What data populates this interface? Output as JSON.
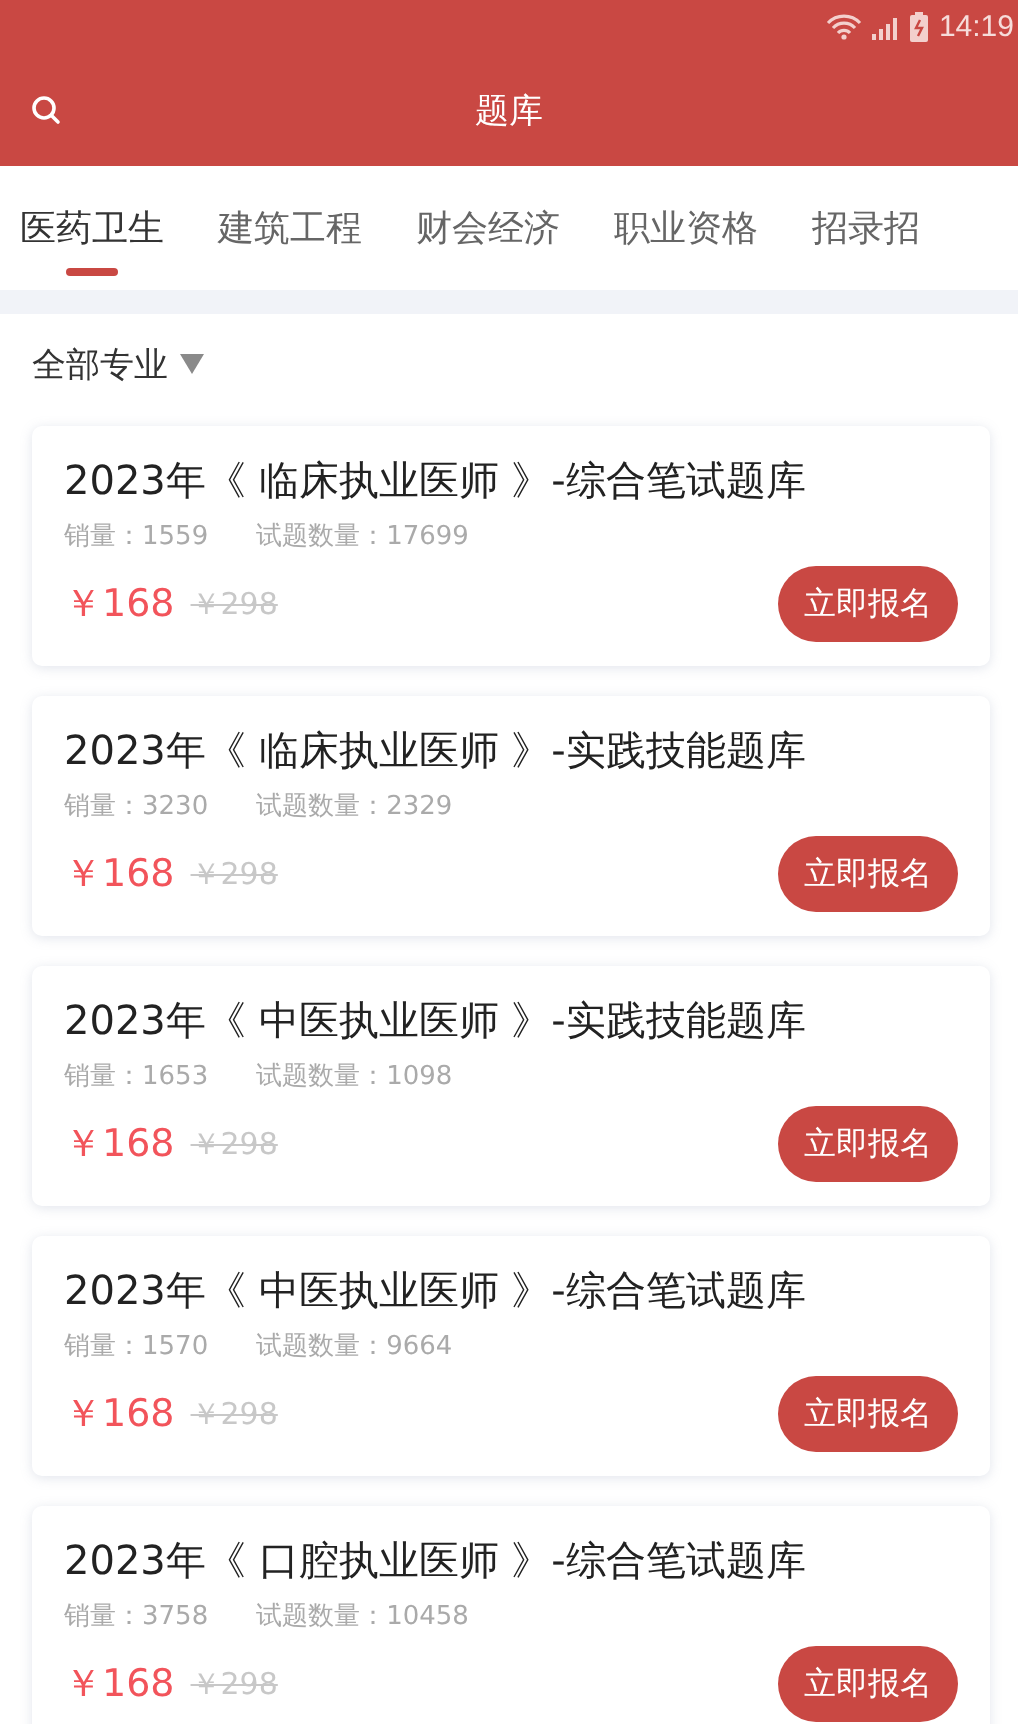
{
  "status_bar": {
    "time": "14:19"
  },
  "header": {
    "title": "题库"
  },
  "tabs": [
    {
      "label": "医药卫生",
      "selected": true
    },
    {
      "label": "建筑工程",
      "selected": false
    },
    {
      "label": "财会经济",
      "selected": false
    },
    {
      "label": "职业资格",
      "selected": false
    },
    {
      "label": "招录招",
      "selected": false
    }
  ],
  "filter": {
    "label": "全部专业"
  },
  "courses": [
    {
      "title": "2023年《 临床执业医师 》-综合笔试题库",
      "sales": "销量：1559",
      "questions": "试题数量：17699",
      "price": "￥168",
      "original_price": "￥298",
      "button": "立即报名"
    },
    {
      "title": "2023年《 临床执业医师 》-实践技能题库",
      "sales": "销量：3230",
      "questions": "试题数量：2329",
      "price": "￥168",
      "original_price": "￥298",
      "button": "立即报名"
    },
    {
      "title": "2023年《 中医执业医师 》-实践技能题库",
      "sales": "销量：1653",
      "questions": "试题数量：1098",
      "price": "￥168",
      "original_price": "￥298",
      "button": "立即报名"
    },
    {
      "title": "2023年《 中医执业医师 》-综合笔试题库",
      "sales": "销量：1570",
      "questions": "试题数量：9664",
      "price": "￥168",
      "original_price": "￥298",
      "button": "立即报名"
    },
    {
      "title": "2023年《 口腔执业医师 》-综合笔试题库",
      "sales": "销量：3758",
      "questions": "试题数量：10458",
      "price": "￥168",
      "original_price": "￥298",
      "button": "立即报名"
    }
  ]
}
